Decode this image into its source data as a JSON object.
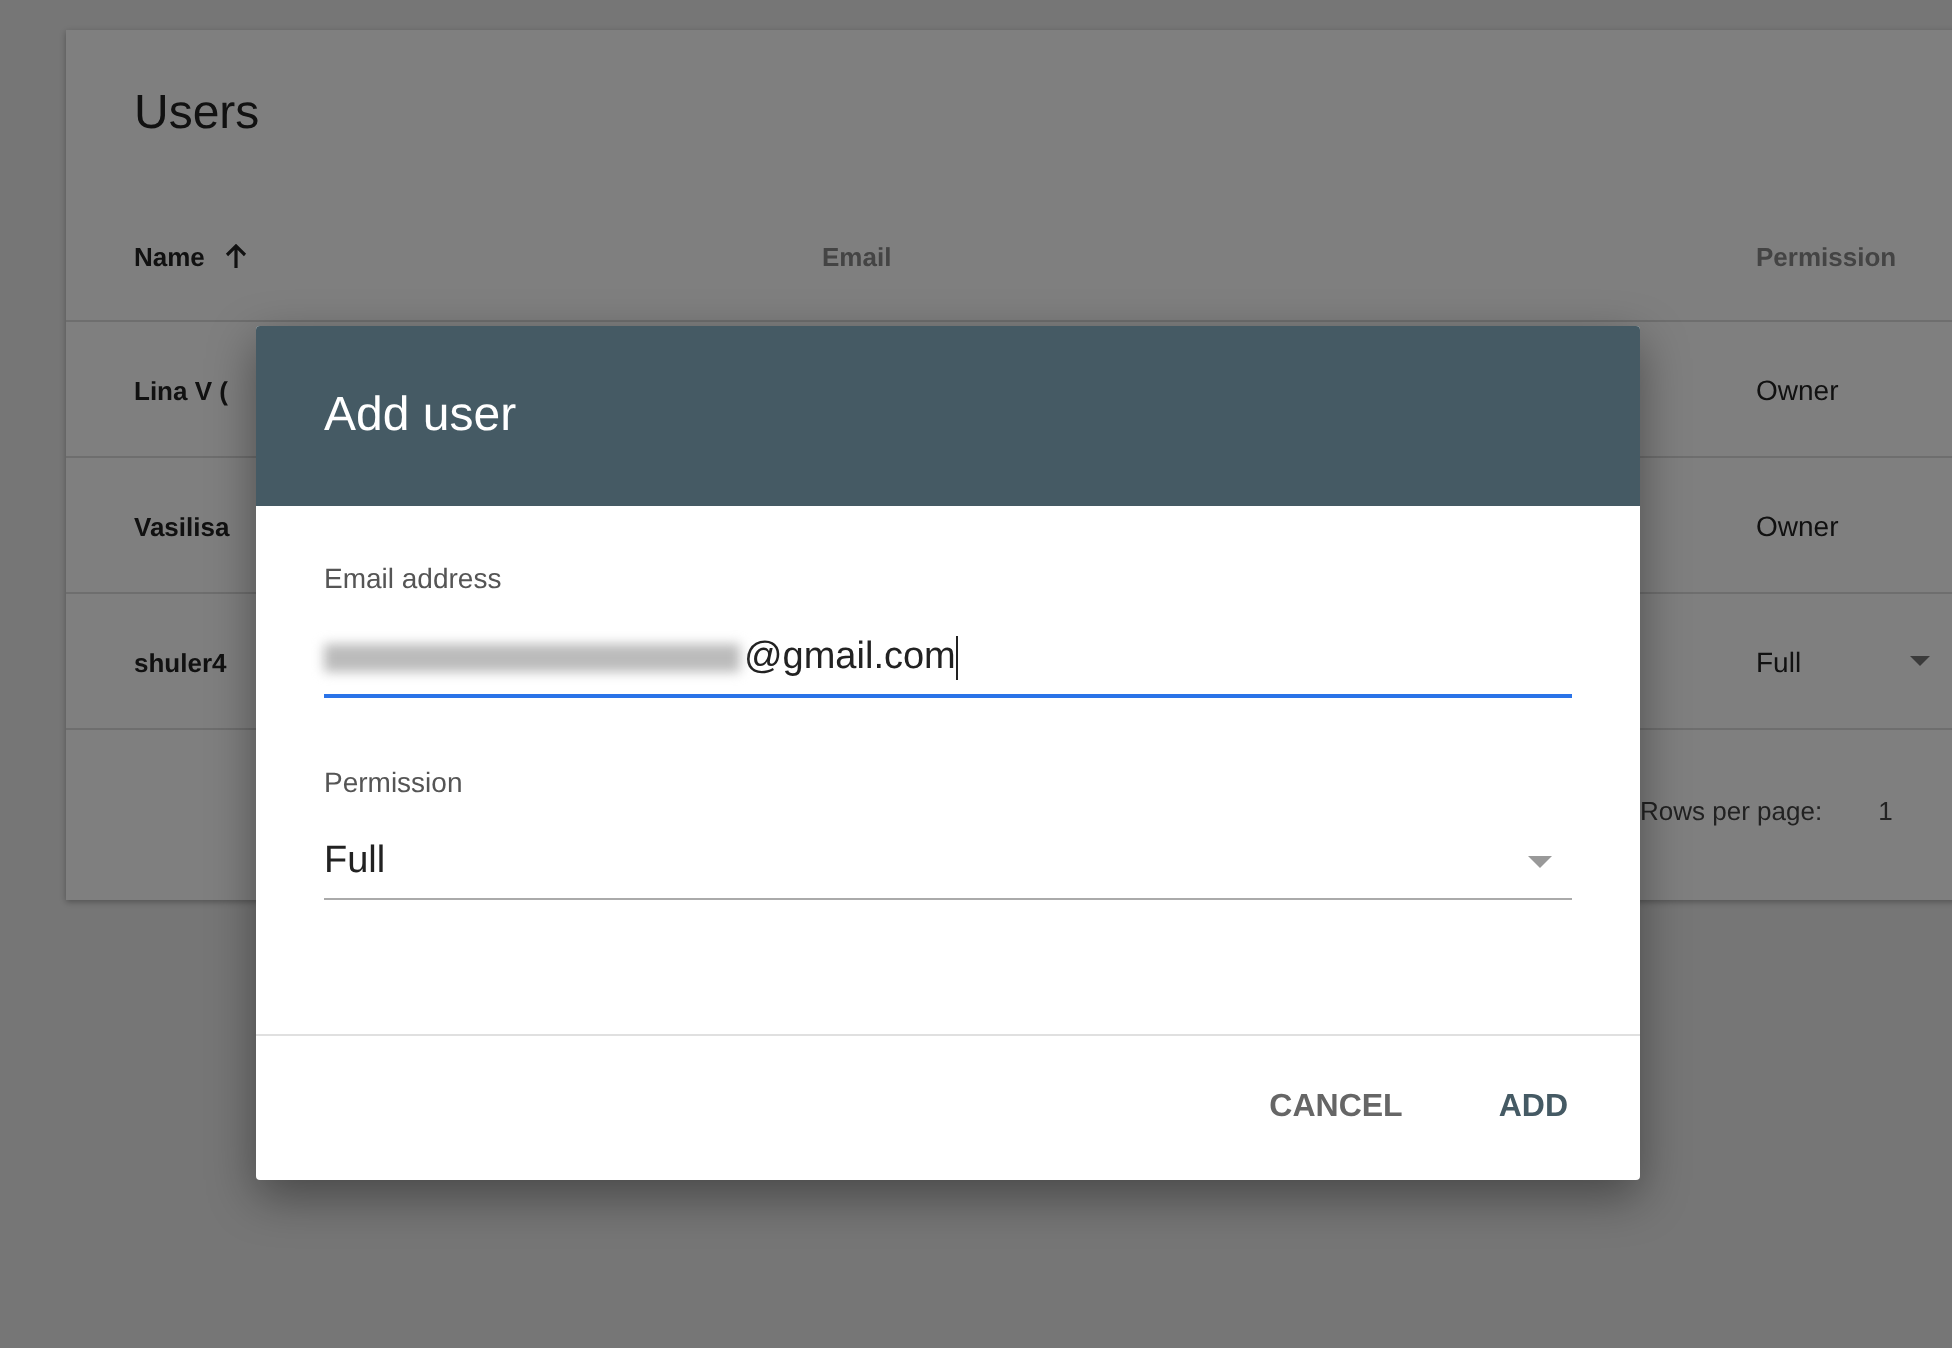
{
  "page": {
    "title": "Users",
    "table": {
      "columns": [
        {
          "label": "Name",
          "sorted": true
        },
        {
          "label": "Email",
          "sorted": false
        },
        {
          "label": "Permission",
          "sorted": false
        }
      ],
      "rows": [
        {
          "name": "Lina V (",
          "permission": "Owner",
          "editable": false
        },
        {
          "name": "Vasilisa",
          "permission": "Owner",
          "editable": false
        },
        {
          "name": "shuler4",
          "permission": "Full",
          "editable": true
        }
      ],
      "footer": {
        "rows_per_page_label": "Rows per page:",
        "rows_per_page_value": "1"
      }
    }
  },
  "dialog": {
    "title": "Add user",
    "fields": [
      {
        "kind": "text",
        "label": "Email address",
        "value": "@gmail.com",
        "redacted": true,
        "focused": true
      },
      {
        "kind": "select",
        "label": "Permission",
        "value": "Full",
        "focused": false
      }
    ],
    "buttons": [
      {
        "label": "CANCEL",
        "primary": false
      },
      {
        "label": "ADD",
        "primary": true
      }
    ]
  }
}
